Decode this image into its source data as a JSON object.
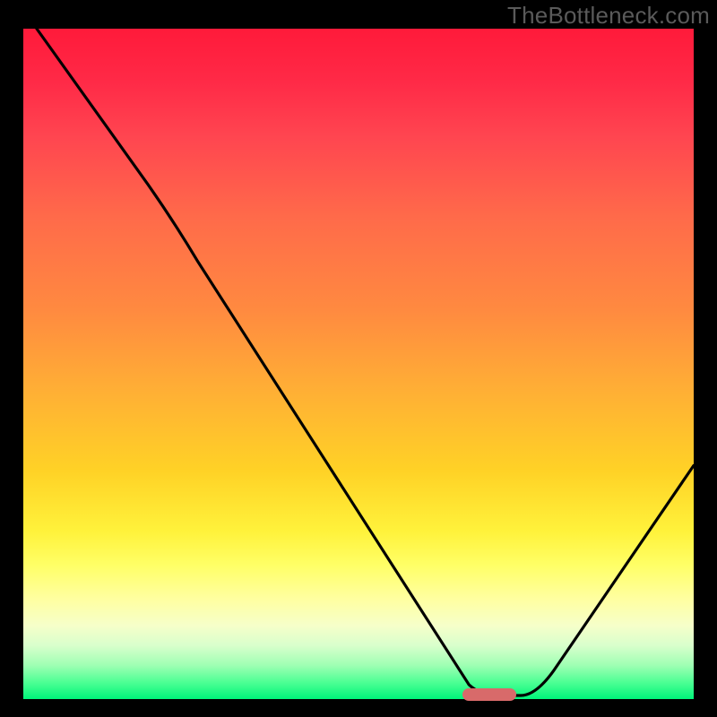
{
  "watermark": "TheBottleneck.com",
  "colors": {
    "background": "#000000",
    "gradient_top": "#ff1a3a",
    "gradient_mid": "#ffd226",
    "gradient_bottom": "#00f57a",
    "curve": "#000000",
    "marker": "#d86a6a",
    "watermark_text": "#5a5a5a"
  },
  "chart_data": {
    "type": "line",
    "title": "",
    "xlabel": "",
    "ylabel": "",
    "xlim": [
      0,
      100
    ],
    "ylim": [
      0,
      100
    ],
    "grid": false,
    "legend": false,
    "description": "Single V-shaped bottleneck curve over a green→red vertical gradient. No axis ticks, labels, or legend are shown. Values below are estimated curve x,y positions in percent of plot area (0,0 = bottom-left).",
    "series": [
      {
        "name": "bottleneck",
        "x": [
          2,
          10,
          20,
          30,
          40,
          50,
          60,
          67,
          72,
          75,
          80,
          90,
          100
        ],
        "y": [
          100,
          88,
          76,
          61,
          46,
          31,
          16,
          4,
          0.5,
          0.5,
          5,
          20,
          35
        ]
      }
    ],
    "annotations": [
      {
        "name": "optimal-range-marker",
        "shape": "pill",
        "x_range_pct": [
          66,
          74
        ],
        "y_pct": 0,
        "color": "#d86a6a"
      }
    ]
  }
}
